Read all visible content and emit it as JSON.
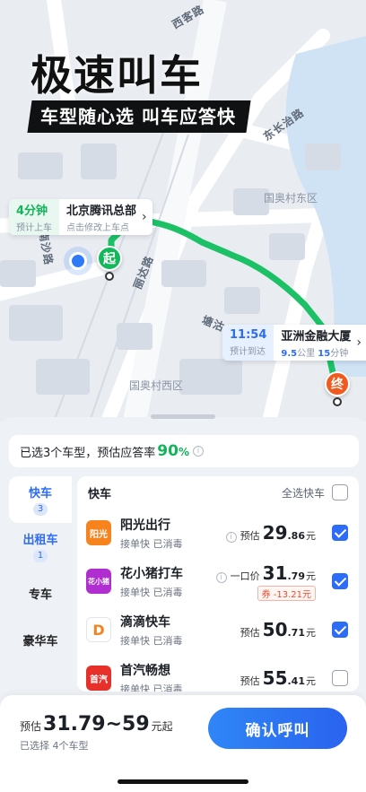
{
  "hero": {
    "title": "极速叫车",
    "subtitle": "车型随心选 叫车应答快"
  },
  "map": {
    "labels": {
      "area1": "国奥村东区",
      "area2": "国奥村西区",
      "road1": "东长治路",
      "road2": "西客路",
      "road3": "南沙路",
      "road4": "丽达路",
      "road5": "塘沽"
    },
    "pickup": {
      "eta": "4分钟",
      "eta_label": "预计上车",
      "place": "北京腾讯总部",
      "hint": "点击修改上车点"
    },
    "dropoff": {
      "time": "11:54",
      "time_label": "预计到达",
      "place": "亚洲金融大厦",
      "distance": "9.5",
      "distance_unit": "公里",
      "duration": "15",
      "duration_unit": "分钟"
    },
    "start_pin": "起",
    "end_pin": "终",
    "route_color": "#1cc166"
  },
  "sheet": {
    "info_prefix": "已选3个车型，预估应答率",
    "info_percent": "90",
    "info_percent_unit": "%",
    "categories": [
      {
        "label": "快车",
        "count": "3",
        "active": true
      },
      {
        "label": "出租车",
        "count": "1"
      },
      {
        "label": "专车"
      },
      {
        "label": "豪华车"
      }
    ],
    "list_title": "快车",
    "select_all_label": "全选快车",
    "cars": [
      {
        "name": "阳光出行",
        "logo_text": "阳光",
        "tags": "接单快 已消毒",
        "price_label": "预估",
        "price_int": "29",
        "price_dec": ".86",
        "unit": "元",
        "checked": true
      },
      {
        "name": "花小猪打车",
        "logo_text": "花小猪",
        "tags": "接单快 已消毒",
        "price_label": "一口价",
        "price_int": "31",
        "price_dec": ".79",
        "unit": "元",
        "coupon": "券 -13.21元",
        "checked": true
      },
      {
        "name": "滴滴快车",
        "logo_text": "D",
        "tags": "接单快 已消毒",
        "price_label": "预估",
        "price_int": "50",
        "price_dec": ".71",
        "unit": "元",
        "checked": true
      },
      {
        "name": "首汽畅想",
        "logo_text": "首汽",
        "tags": "接单快 已消毒",
        "price_label": "预估",
        "price_int": "55",
        "price_dec": ".41",
        "unit": "元",
        "checked": false
      }
    ]
  },
  "footer": {
    "price_label": "预估",
    "price_range": "31.79~59",
    "price_suffix": "元起",
    "selected_text": "已选择 4个车型",
    "confirm_label": "确认呼叫"
  },
  "colors": {
    "accent": "#2d6cf6",
    "green": "#12b35b",
    "orange": "#f05a1e"
  }
}
